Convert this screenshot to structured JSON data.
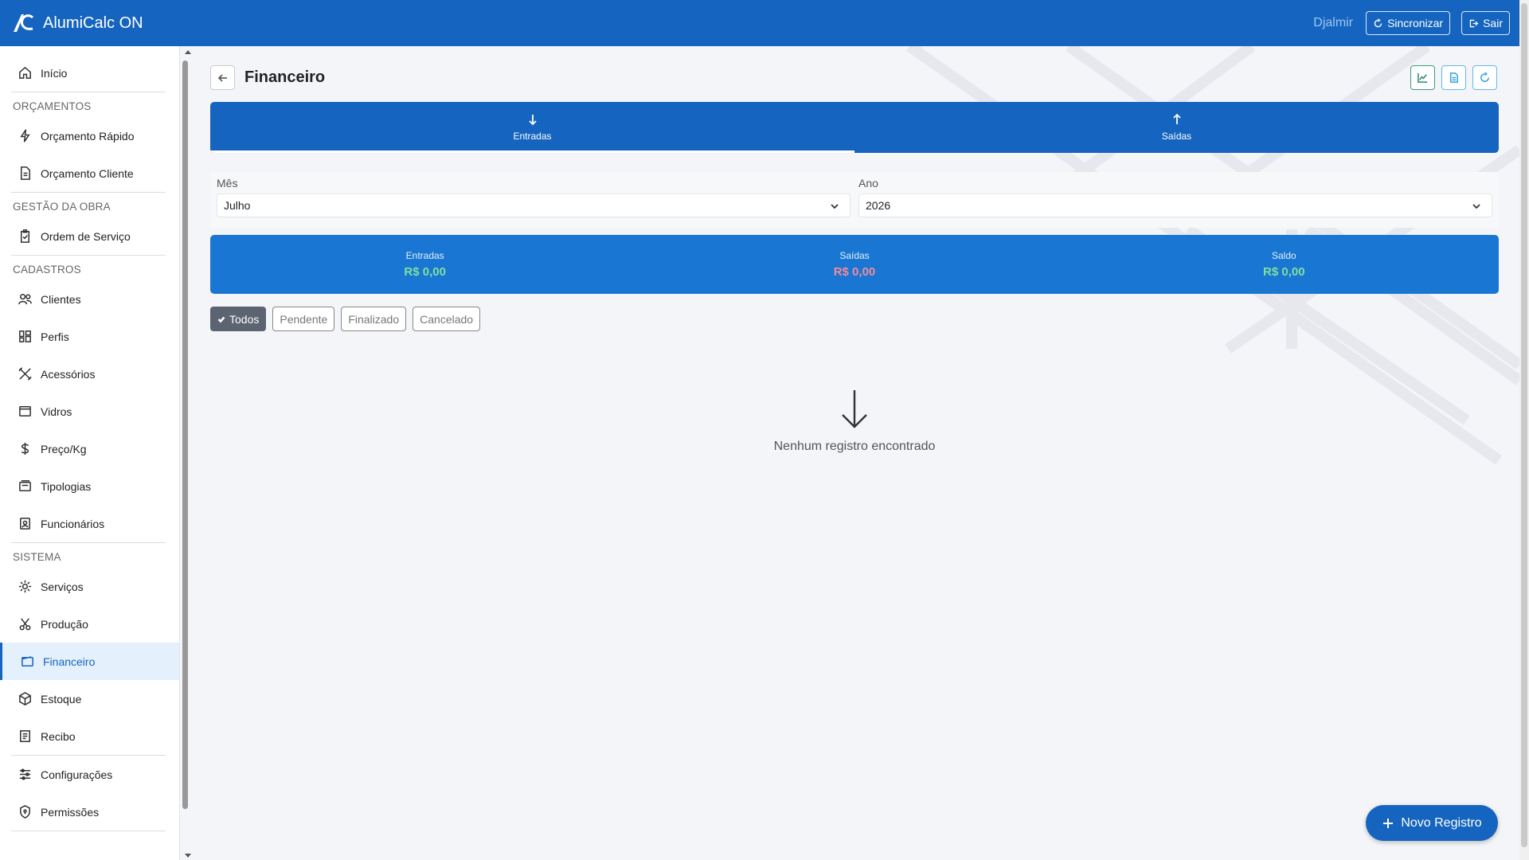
{
  "app": {
    "title": "AlumiCalc ON"
  },
  "topbar": {
    "user": "Djalmir",
    "sync_label": "Sincronizar",
    "logout_label": "Sair"
  },
  "sidebar": {
    "home": "Início",
    "sections": {
      "orcamentos": "ORÇAMENTOS",
      "gestao": "GESTÃO DA OBRA",
      "cadastros": "CADASTROS",
      "sistema": "SISTEMA"
    },
    "items": {
      "orcamento_rapido": "Orçamento Rápido",
      "orcamento_cliente": "Orçamento Cliente",
      "ordem_servico": "Ordem de Serviço",
      "clientes": "Clientes",
      "perfis": "Perfis",
      "acessorios": "Acessórios",
      "vidros": "Vidros",
      "preco_kg": "Preço/Kg",
      "tipologias": "Tipologias",
      "funcionarios": "Funcionários",
      "servicos": "Serviços",
      "producao": "Produção",
      "financeiro": "Financeiro",
      "estoque": "Estoque",
      "recibo": "Recibo",
      "configuracoes": "Configurações",
      "permissoes": "Permissões"
    },
    "active": "financeiro"
  },
  "page": {
    "title": "Financeiro"
  },
  "tabs": [
    {
      "label": "Entradas",
      "icon": "arrow-down-icon",
      "active": true
    },
    {
      "label": "Saídas",
      "icon": "arrow-up-icon",
      "active": false
    }
  ],
  "filters": {
    "month_label": "Mês",
    "month_value": "Julho",
    "year_label": "Ano",
    "year_value": "2026"
  },
  "summary": {
    "entradas_label": "Entradas",
    "entradas_value": "R$ 0,00",
    "saidas_label": "Saídas",
    "saidas_value": "R$ 0,00",
    "saldo_label": "Saldo",
    "saldo_value": "R$ 0,00"
  },
  "status_filters": [
    "Todos",
    "Pendente",
    "Finalizado",
    "Cancelado"
  ],
  "empty_state": {
    "text": "Nenhum registro encontrado",
    "icon": "arrow-down-icon"
  },
  "fab": {
    "label": "Novo Registro",
    "icon": "plus-icon"
  },
  "colors": {
    "primary": "#1565c0",
    "summary_bg": "#1976d2",
    "positive": "#7ee0a0",
    "negative": "#f28b9b"
  }
}
